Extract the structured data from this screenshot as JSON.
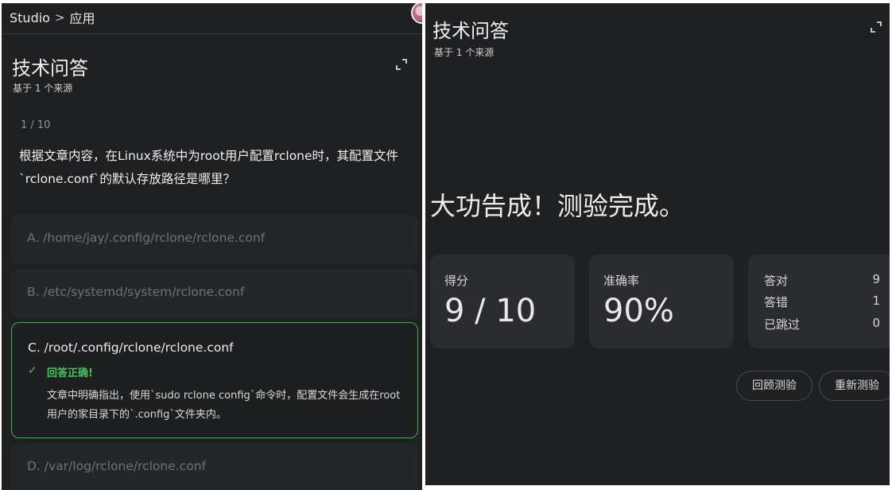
{
  "breadcrumb": {
    "root": "Studio",
    "separator": ">",
    "current": "应用"
  },
  "left_panel": {
    "title": "技术问答",
    "subtitle": "基于 1 个来源",
    "progress": "1 / 10",
    "question": "根据文章内容，在Linux系统中为root用户配置rclone时，其配置文件`rclone.conf`的默认存放路径是哪里？",
    "options": [
      {
        "text": "A.  /home/jay/.config/rclone/rclone.conf"
      },
      {
        "text": "B.  /etc/systemd/system/rclone.conf"
      },
      {
        "text": "C.  /root/.config/rclone/rclone.conf",
        "feedback": "回答正确!",
        "explanation": "文章中明确指出，使用`sudo rclone config`命令时，配置文件会生成在root用户的家目录下的`.config`文件夹内。"
      },
      {
        "text": "D.  /var/log/rclone/rclone.conf"
      }
    ]
  },
  "right_panel": {
    "title": "技术问答",
    "subtitle": "基于 1 个来源",
    "completion": "大功告成！测验完成。",
    "score": {
      "label": "得分",
      "value": "9 / 10"
    },
    "accuracy": {
      "label": "准确率",
      "value": "90%"
    },
    "stats": [
      {
        "label": "答对",
        "value": "9"
      },
      {
        "label": "答错",
        "value": "1"
      },
      {
        "label": "已跳过",
        "value": "0"
      }
    ],
    "buttons": {
      "review": "回顾测验",
      "retake": "重新测验"
    }
  },
  "colors": {
    "panel_bg": "#1f2022",
    "card_bg": "#2b2c2f",
    "correct_green": "#37b24d",
    "muted_text": "#6f7175"
  },
  "icons": {
    "expand": "expand-icon",
    "correct": "check-icon"
  }
}
